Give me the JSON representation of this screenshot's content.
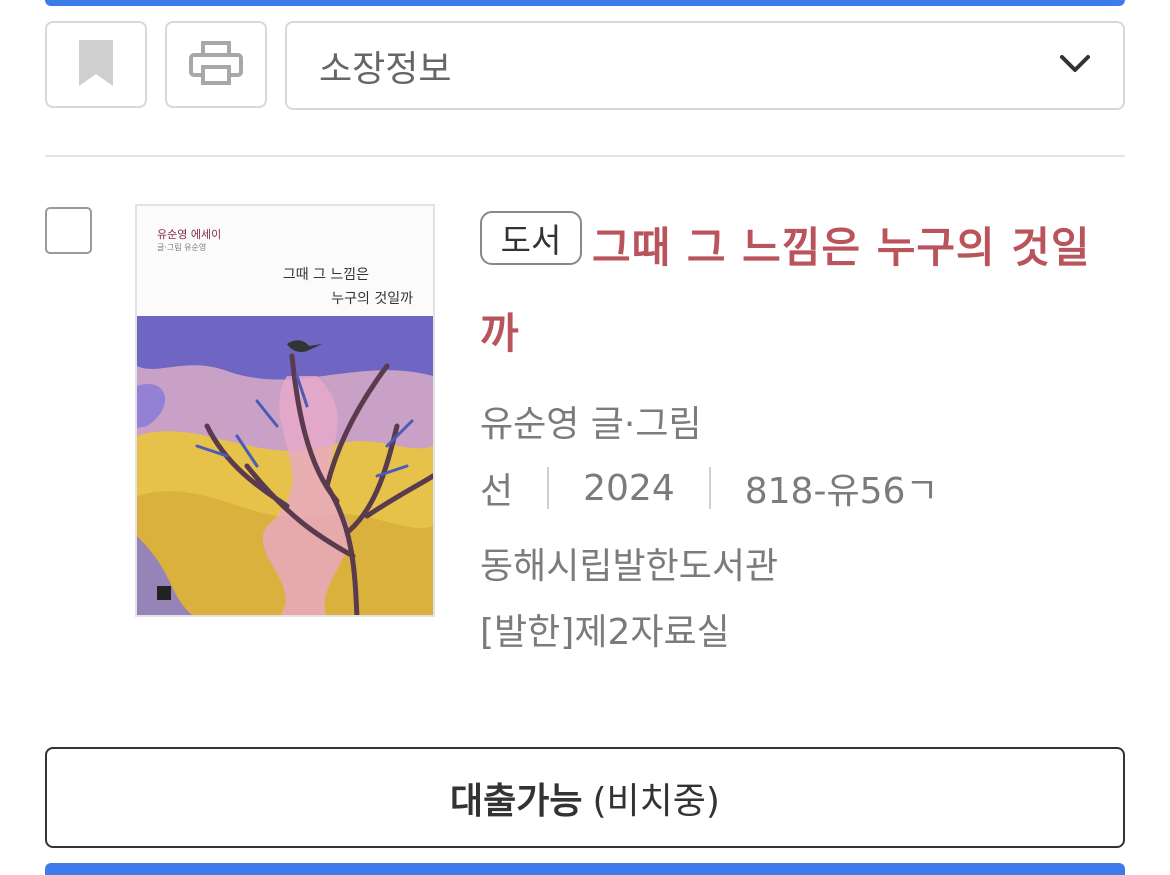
{
  "toolbar": {
    "bookmark_icon": "bookmark-icon",
    "print_icon": "printer-icon",
    "select_value": "소장정보",
    "select_icon": "chevron-down-icon"
  },
  "result": {
    "type_badge": "도서",
    "title": "그때 그 느낌은 누구의 것일까",
    "author": "유순영 글·그림",
    "publisher": "선",
    "year": "2024",
    "call_number": "818-유56ㄱ",
    "library": "동해시립발한도서관",
    "room": "[발한]제2자료실",
    "cover": {
      "series": "유순영 에세이",
      "byline": "글·그림 유순영",
      "title_line1": "그때 그 느낌은",
      "title_line2": "누구의 것일까"
    },
    "status_main": "대출가능",
    "status_sub": "(비치중)"
  },
  "colors": {
    "accent_blue": "#3d7be8",
    "title_red": "#b9545c",
    "border_gray": "#d8d8d8"
  }
}
